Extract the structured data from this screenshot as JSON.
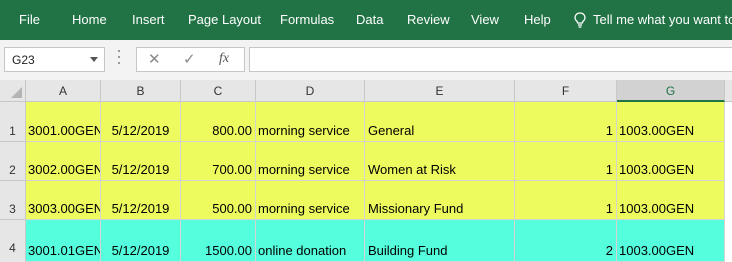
{
  "ribbon": {
    "tabs": [
      "File",
      "Home",
      "Insert",
      "Page Layout",
      "Formulas",
      "Data",
      "Review",
      "View",
      "Help"
    ],
    "tell_me": "Tell me what you want to do",
    "background": "#217346"
  },
  "formula_bar": {
    "name_box": "G23",
    "cancel_icon": "✕",
    "enter_icon": "✓",
    "fx_label": "fx",
    "formula": ""
  },
  "sheet": {
    "columns": [
      "A",
      "B",
      "C",
      "D",
      "E",
      "F",
      "G"
    ],
    "selected_column": "G",
    "rows": [
      {
        "num": "1",
        "fill": "#eefb5e",
        "cells": [
          "3001.00GEN",
          "5/12/2019",
          "800.00",
          "morning service",
          "General",
          "1",
          "1003.00GEN"
        ]
      },
      {
        "num": "2",
        "fill": "#eefb5e",
        "cells": [
          "3002.00GEN",
          "5/12/2019",
          "700.00",
          "morning service",
          "Women at Risk",
          "1",
          "1003.00GEN"
        ]
      },
      {
        "num": "3",
        "fill": "#eefb5e",
        "cells": [
          "3003.00GEN",
          "5/12/2019",
          "500.00",
          "morning service",
          "Missionary Fund",
          "1",
          "1003.00GEN"
        ]
      },
      {
        "num": "4",
        "fill": "#55ffdd",
        "cells": [
          "3001.01GEN",
          "5/12/2019",
          "1500.00",
          "online donation",
          "Building Fund",
          "2",
          "1003.00GEN"
        ]
      }
    ]
  }
}
